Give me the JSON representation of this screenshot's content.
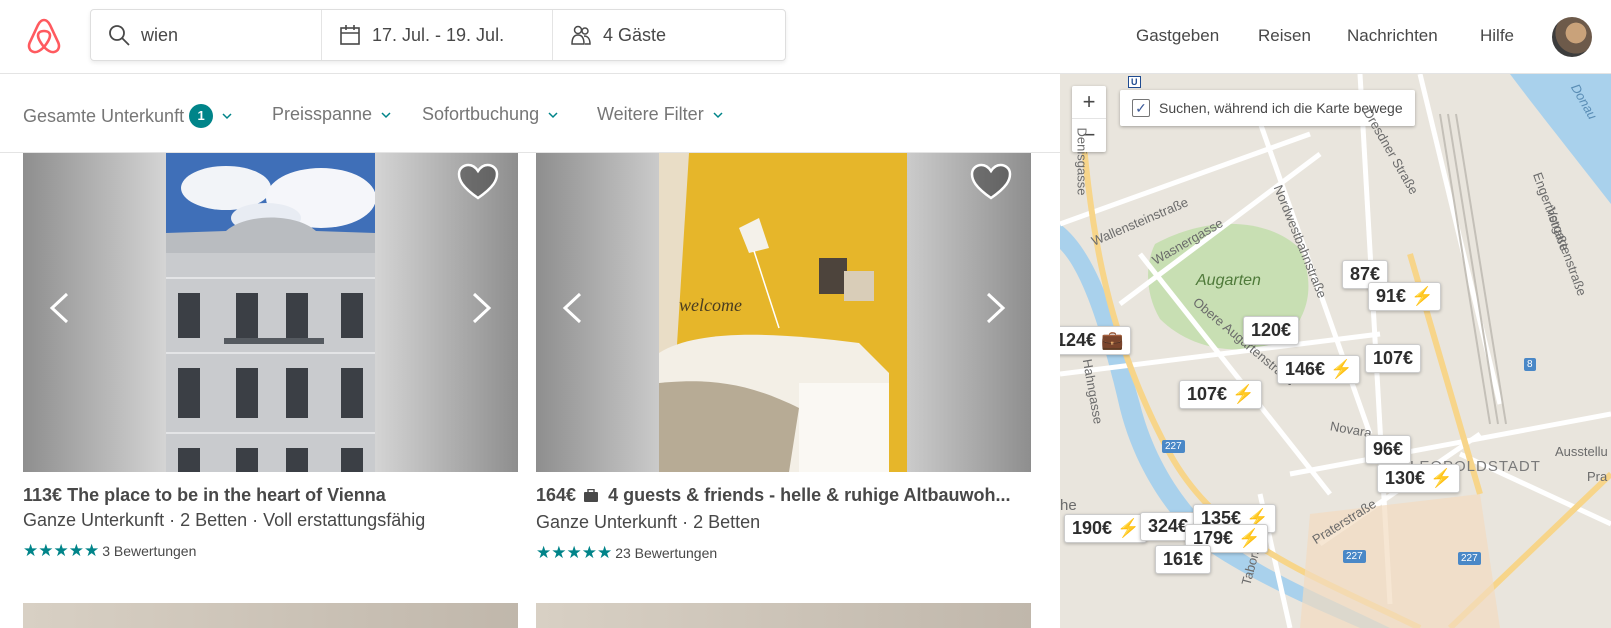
{
  "header": {
    "search": {
      "location": "wien",
      "dates": "17. Jul. - 19. Jul.",
      "guests": "4 Gäste"
    },
    "nav": [
      "Gastgeben",
      "Reisen",
      "Nachrichten",
      "Hilfe"
    ]
  },
  "filters": {
    "entire_place": "Gesamte Unterkunft",
    "entire_place_count": "1",
    "price": "Preisspanne",
    "instant_book": "Sofortbuchung",
    "more": "Weitere Filter"
  },
  "listings": [
    {
      "price": "113€",
      "name": "The place to be in the heart of Vienna",
      "details": "Ganze Unterkunft · 2 Betten · Voll erstattungsfähig",
      "stars": "★★★★★",
      "reviews": "3 Bewertungen"
    },
    {
      "price": "164€",
      "name": "4 guests & friends - helle & ruhige Altbauwoh...",
      "details": "Ganze Unterkunft · 2 Betten",
      "stars": "★★★★★",
      "reviews": "23 Bewertungen"
    }
  ],
  "map": {
    "search_while_moving": "Suchen, während ich die Karte bewege",
    "zoom_in": "+",
    "zoom_out": "−",
    "labels": {
      "augarten": "Augarten",
      "wallensteinstrasse": "Wallensteinstraße",
      "wasnergasse": "Wasnergasse",
      "nordwestbahnstrasse": "Nordwestbahnstraße",
      "dresdner": "Dresdner Straße",
      "obere_augarten": "Obere Augartenstraße",
      "taborstrasse": "Taborstraße",
      "praterstrasse": "Praterstraße",
      "novara": "Novara",
      "leopoldstadt": "LEOPOLDSTADT",
      "donau": "Donau",
      "ausstellung": "Ausstellu",
      "hahngasse": "Hahngasse",
      "denisgasse": "Denisgasse",
      "engerth": "Engerthstraße",
      "vorgarten": "Vorgartenstraße",
      "pra": "Pra",
      "he": "he",
      "line_227_a": "227",
      "line_227_b": "227",
      "line_227_c": "227",
      "line_8_a": "8",
      "line_8_b": "8",
      "ubahn": "U"
    },
    "pins": [
      {
        "id": "pin-87",
        "label": "87€"
      },
      {
        "id": "pin-91",
        "label": "91€ ⚡"
      },
      {
        "id": "pin-124",
        "label": "124€ 💼"
      },
      {
        "id": "pin-120",
        "label": "120€"
      },
      {
        "id": "pin-146",
        "label": "146€ ⚡"
      },
      {
        "id": "pin-107a",
        "label": "107€"
      },
      {
        "id": "pin-107b",
        "label": "107€ ⚡"
      },
      {
        "id": "pin-96",
        "label": "96€"
      },
      {
        "id": "pin-130",
        "label": "130€ ⚡"
      },
      {
        "id": "pin-190",
        "label": "190€ ⚡"
      },
      {
        "id": "pin-324",
        "label": "324€ ⚡"
      },
      {
        "id": "pin-135",
        "label": "135€ ⚡"
      },
      {
        "id": "pin-179",
        "label": "179€ ⚡"
      },
      {
        "id": "pin-161",
        "label": "161€"
      }
    ]
  },
  "colors": {
    "brand": "#FF5A5F",
    "teal": "#008489",
    "text": "#484848"
  }
}
